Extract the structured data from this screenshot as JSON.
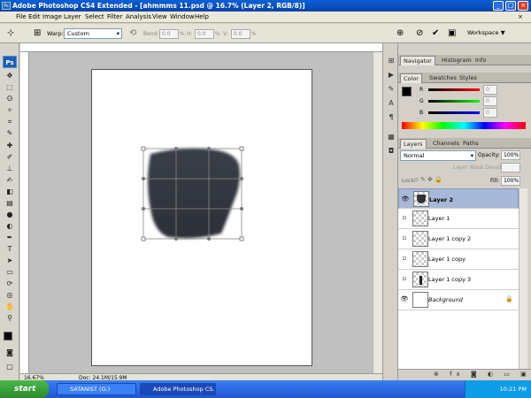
{
  "titlebar": {
    "title": "Adobe Photoshop CS4 Extended - [ahmmms 11.psd @ 16.7% (Layer 2, RGB/8)]"
  },
  "menu": [
    "File",
    "Edit",
    "Image",
    "Layer",
    "Select",
    "Filter",
    "Analysis",
    "View",
    "Window",
    "Help"
  ],
  "options": {
    "warp_label": "Warp:",
    "warp_value": "Custom",
    "bend_label": "Bend:",
    "bend_value": "0.0",
    "h_label": "H:",
    "h_value": "0.0",
    "v_label": "V:",
    "v_value": "0.0",
    "workspace": "Workspace ▼"
  },
  "status": {
    "zoom": "16.67%",
    "doc": "Doc: 24.1M/15.9M"
  },
  "nav_tabs": [
    "Navigator",
    "Histogram",
    "Info"
  ],
  "color_tabs": [
    "Color",
    "Swatches",
    "Styles"
  ],
  "color": {
    "r": "0",
    "g": "0",
    "b": "0"
  },
  "layers_tabs": [
    "Layers",
    "Channels",
    "Paths"
  ],
  "layers": {
    "blend_mode": "Normal",
    "opacity_label": "Opacity:",
    "opacity": "100%",
    "mask_density": "Layer Mask Density:",
    "lock_label": "Lock:",
    "fill_label": "Fill:",
    "fill": "100%",
    "items": [
      {
        "name": "Layer 2"
      },
      {
        "name": "Layer 1"
      },
      {
        "name": "Layer 1 copy 2"
      },
      {
        "name": "Layer 1 copy"
      },
      {
        "name": "Layer 1 copy 3"
      },
      {
        "name": "Background"
      }
    ]
  },
  "taskbar": {
    "start": "start",
    "task1": "SATANIST (G:)",
    "task2": "Adobe Photoshop CS...",
    "clock": "10:21 PM"
  }
}
